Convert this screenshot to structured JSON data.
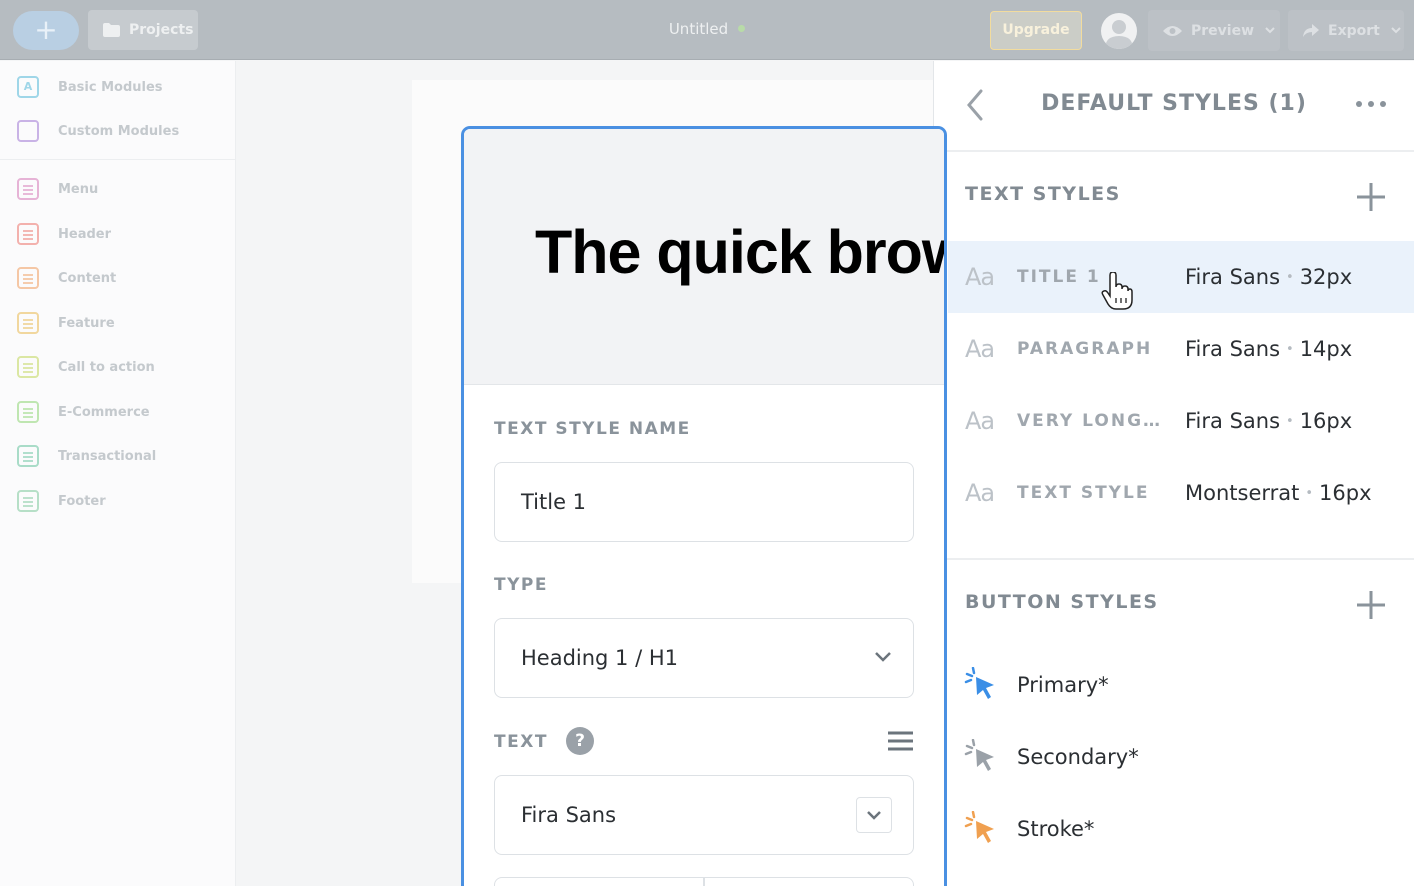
{
  "topbar": {
    "add_label": "+",
    "projects_label": "Projects",
    "doc_title": "Untitled",
    "upgrade_label": "Upgrade",
    "preview_label": "Preview",
    "export_label": "Export"
  },
  "sidebar": {
    "items": [
      {
        "label": "Basic Modules",
        "color": "#9fd6e8",
        "icon": "basic-modules-icon"
      },
      {
        "label": "Custom Modules",
        "color": "#c9b3e6",
        "icon": "custom-modules-icon"
      },
      {
        "label": "Menu",
        "color": "#e6b3d6",
        "icon": "menu-module-icon"
      },
      {
        "label": "Header",
        "color": "#f3b1ad",
        "icon": "header-module-icon"
      },
      {
        "label": "Content",
        "color": "#f5c7a5",
        "icon": "content-module-icon"
      },
      {
        "label": "Feature",
        "color": "#f1d79e",
        "icon": "feature-module-icon"
      },
      {
        "label": "Call to action",
        "color": "#dbe7a3",
        "icon": "call-to-action-module-icon"
      },
      {
        "label": "E-Commerce",
        "color": "#bfe6b1",
        "icon": "ecommerce-module-icon"
      },
      {
        "label": "Transactional",
        "color": "#a9dcc8",
        "icon": "transactional-module-icon"
      },
      {
        "label": "Footer",
        "color": "#b6dfc7",
        "icon": "footer-module-icon"
      }
    ]
  },
  "editor": {
    "preview_text": "The quick brown fox jumps over the lazy dog",
    "name_label": "TEXT STYLE NAME",
    "name_value": "Title 1",
    "type_label": "TYPE",
    "type_value": "Heading 1 / H1",
    "text_label": "TEXT",
    "help_glyph": "?",
    "font_value": "Fira Sans"
  },
  "panel": {
    "title": "DEFAULT STYLES (1)",
    "text_styles_label": "TEXT STYLES",
    "aa_glyph": "Aa",
    "dot": "•",
    "text_styles": [
      {
        "name": "TITLE 1",
        "font": "Fira Sans",
        "size": "32px"
      },
      {
        "name": "PARAGRAPH",
        "font": "Fira Sans",
        "size": "14px"
      },
      {
        "name": "VERY LONG TEXT STYLE NAME",
        "font": "Fira Sans",
        "size": "16px"
      },
      {
        "name": "TEXT STYLE",
        "font": "Montserrat",
        "size": "16px"
      }
    ],
    "button_styles_label": "BUTTON STYLES",
    "button_styles": [
      {
        "name": "Primary*",
        "color": "#3a8ee6"
      },
      {
        "name": "Secondary*",
        "color": "#9aa1a8"
      },
      {
        "name": "Stroke*",
        "color": "#f0a050"
      }
    ]
  },
  "colors": {
    "accent": "#4a90e2",
    "active_row": "#eaf2fb"
  }
}
